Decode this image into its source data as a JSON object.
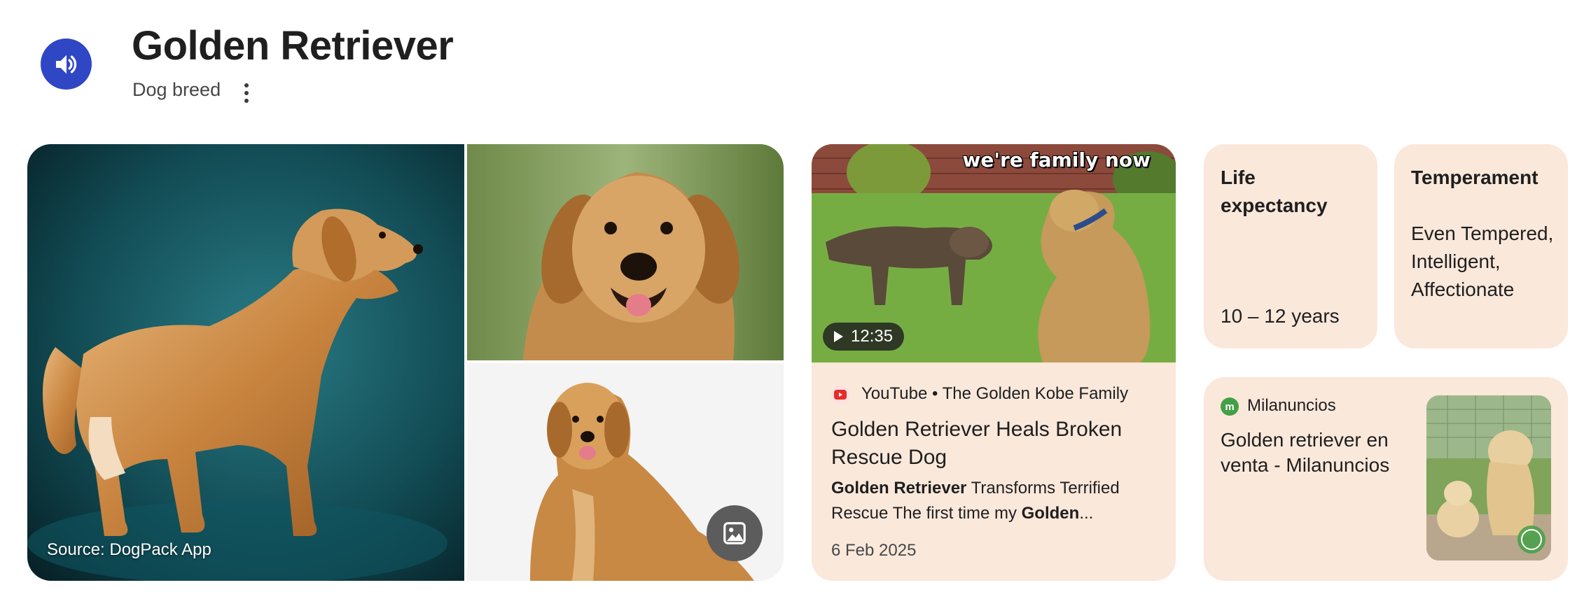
{
  "header": {
    "title": "Golden Retriever",
    "subtitle": "Dog breed"
  },
  "collage": {
    "source_caption": "Source: DogPack App"
  },
  "video": {
    "overlay_text": "we're family now",
    "duration": "12:35",
    "source": "YouTube • The Golden Kobe Family",
    "title": "Golden Retriever Heals Broken Rescue Dog",
    "snippet_bold_1": "Golden Retriever",
    "snippet_text_1": " Transforms Terrified Rescue The first time my ",
    "snippet_bold_2": "Golden",
    "snippet_text_2": "...",
    "date": "6 Feb 2025"
  },
  "facts": {
    "life_label": "Life expectancy",
    "life_value": "10 – 12 years",
    "temp_label": "Temperament",
    "temp_value": "Even Tempered, Intelligent, Affectionate"
  },
  "listing": {
    "source": "Milanuncios",
    "title": "Golden retriever en venta - Milanuncios",
    "icon_letter": "m"
  },
  "colors": {
    "accent_blue": "#2f47c4",
    "card_bg": "#fae8db",
    "youtube_red": "#e52d27",
    "milanuncios_green": "#43a047"
  }
}
